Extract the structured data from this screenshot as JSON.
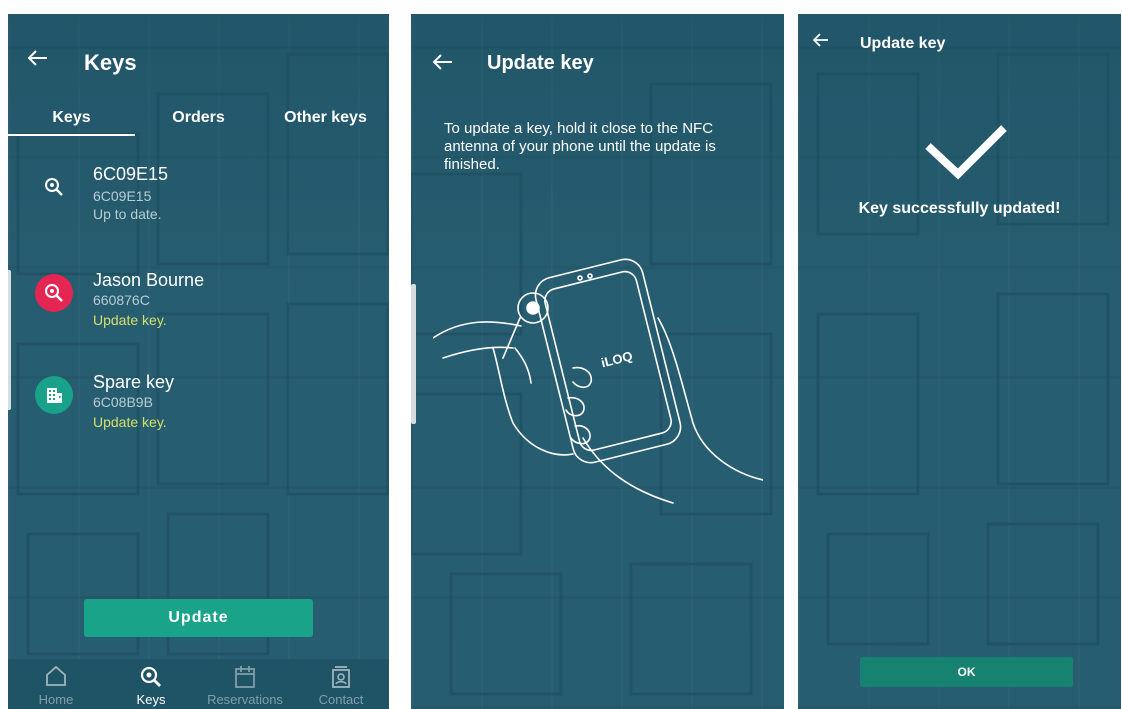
{
  "screen1": {
    "title": "Keys",
    "tabs": [
      {
        "label": "Keys",
        "active": true
      },
      {
        "label": "Orders",
        "active": false
      },
      {
        "label": "Other keys",
        "active": false
      }
    ],
    "keys": [
      {
        "name": "6C09E15",
        "code": "6C09E15",
        "status": "Up to date.",
        "icon": "key-search-icon",
        "avatar_color": "transparent",
        "status_color": "#b6ccd4"
      },
      {
        "name": "Jason Bourne",
        "code": "660876C",
        "status": "Update key.",
        "icon": "key-search-icon",
        "avatar_color": "#e52552",
        "status_color": "#d5e06a"
      },
      {
        "name": "Spare key",
        "code": "6C08B9B",
        "status": "Update key.",
        "icon": "building-icon",
        "avatar_color": "#1aa189",
        "status_color": "#d5e06a"
      }
    ],
    "update_button": "Update",
    "nav": [
      {
        "label": "Home",
        "icon": "home-icon",
        "active": false
      },
      {
        "label": "Keys",
        "icon": "key-search-icon",
        "active": true
      },
      {
        "label": "Reservations",
        "icon": "calendar-icon",
        "active": false
      },
      {
        "label": "Contact",
        "icon": "contact-icon",
        "active": false
      }
    ]
  },
  "screen2": {
    "title": "Update key",
    "instruction": "To update a key, hold it close to the NFC antenna of your phone until the update is finished.",
    "phone_logo": "iLOQ"
  },
  "screen3": {
    "title": "Update key",
    "message": "Key successfully updated!",
    "ok_button": "OK"
  },
  "colors": {
    "background": "#275d70",
    "accent": "#19a489",
    "alert": "#e52552",
    "update_text": "#d5e06a"
  }
}
